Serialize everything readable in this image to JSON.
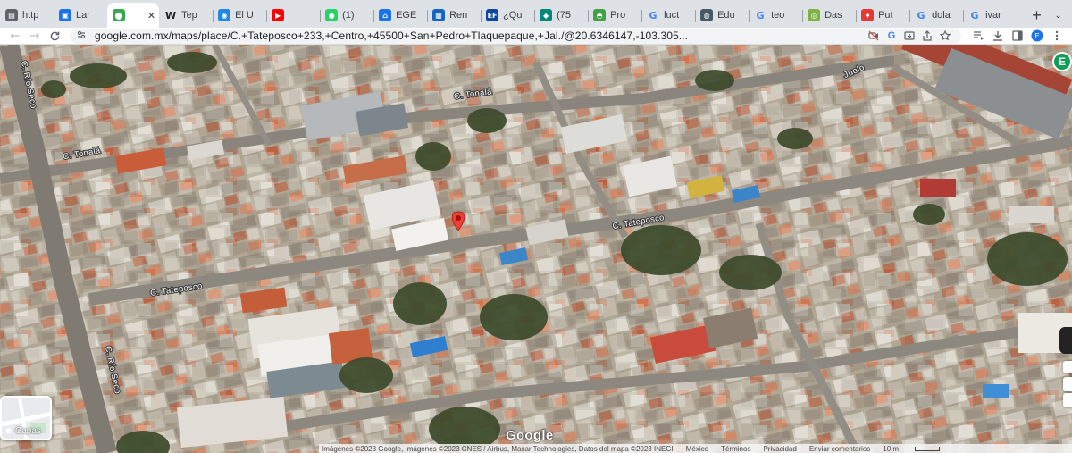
{
  "tabs": [
    {
      "label": "http",
      "favicon": "document-icon",
      "color": "#5f6368"
    },
    {
      "label": "Lar",
      "favicon": "bookmark-icon",
      "color": "#1a73e8"
    },
    {
      "label": "",
      "favicon": "maps-pin-icon",
      "color": "#34a853",
      "active": true
    },
    {
      "label": "Tep",
      "favicon": "wikipedia-icon",
      "color": "#202124"
    },
    {
      "label": "El U",
      "favicon": "newspaper-icon",
      "color": "#1e88e5"
    },
    {
      "label": "",
      "favicon": "youtube-icon",
      "color": "#ff0000"
    },
    {
      "label": "(1)",
      "favicon": "whatsapp-icon",
      "color": "#25d366"
    },
    {
      "label": "EGE",
      "favicon": "house-icon",
      "color": "#1a73e8"
    },
    {
      "label": "Ren",
      "favicon": "building-icon",
      "color": "#1565c0"
    },
    {
      "label": "¿Qu",
      "favicon": "ef-icon",
      "color": "#0d47a1"
    },
    {
      "label": "(75",
      "favicon": "cube-icon",
      "color": "#00897b"
    },
    {
      "label": "Pro",
      "favicon": "leaf-icon",
      "color": "#43a047"
    },
    {
      "label": "luct",
      "favicon": "google-icon",
      "color": "#4285f4"
    },
    {
      "label": "Edu",
      "favicon": "globe-icon",
      "color": "#455a64"
    },
    {
      "label": "teo",
      "favicon": "google-icon",
      "color": "#4285f4"
    },
    {
      "label": "Das",
      "favicon": "circle-icon",
      "color": "#7cb342"
    },
    {
      "label": "Put",
      "favicon": "pin-icon",
      "color": "#e53935"
    },
    {
      "label": "dola",
      "favicon": "google-icon",
      "color": "#4285f4"
    },
    {
      "label": "ivar",
      "favicon": "google-icon",
      "color": "#4285f4"
    }
  ],
  "active_tab_close": "✕",
  "new_tab": "+",
  "tab_search": "⌄",
  "toolbar": {
    "back": "←",
    "forward": "→",
    "reload": "C",
    "url": "google.com.mx/maps/place/C.+Tateposco+233,+Centro,+45500+San+Pedro+Tlaquepaque,+Jal./@20.6346147,-103.305..."
  },
  "omnibox_icons": [
    "camera-off-icon",
    "google-icon",
    "install-icon",
    "share-icon",
    "star-icon"
  ],
  "extension_icons": [
    "playlist-icon",
    "download-icon",
    "sidepanel-icon",
    "profile-icon"
  ],
  "map": {
    "streets": {
      "tonala_1": "C. Tonalá",
      "tonala_2": "C. Tonalá",
      "tateposco_1": "C. Tateposco",
      "tateposco_2": "C. Tateposco",
      "rio_seco_1": "C. Río Seco",
      "rio_seco_2": "C. Río Seco",
      "juelo": "Juelo"
    },
    "avatar_letter": "E",
    "layers_label": "Capas",
    "logo": "Google",
    "attribution": "Imágenes ©2023 Google, Imágenes ©2023 CNES / Airbus, Maxar Technologies, Datos del mapa ©2023 INEGI",
    "footer_links": [
      "México",
      "Términos",
      "Privacidad",
      "Enviar comentarios"
    ],
    "scale": "10 m"
  },
  "colors": {
    "tabstrip_bg": "#dee1e6",
    "toolbar_bg": "#ffffff",
    "omnibox_bg": "#f1f3f4",
    "pin_red": "#ea4335",
    "avatar_green": "#0f9d58"
  }
}
